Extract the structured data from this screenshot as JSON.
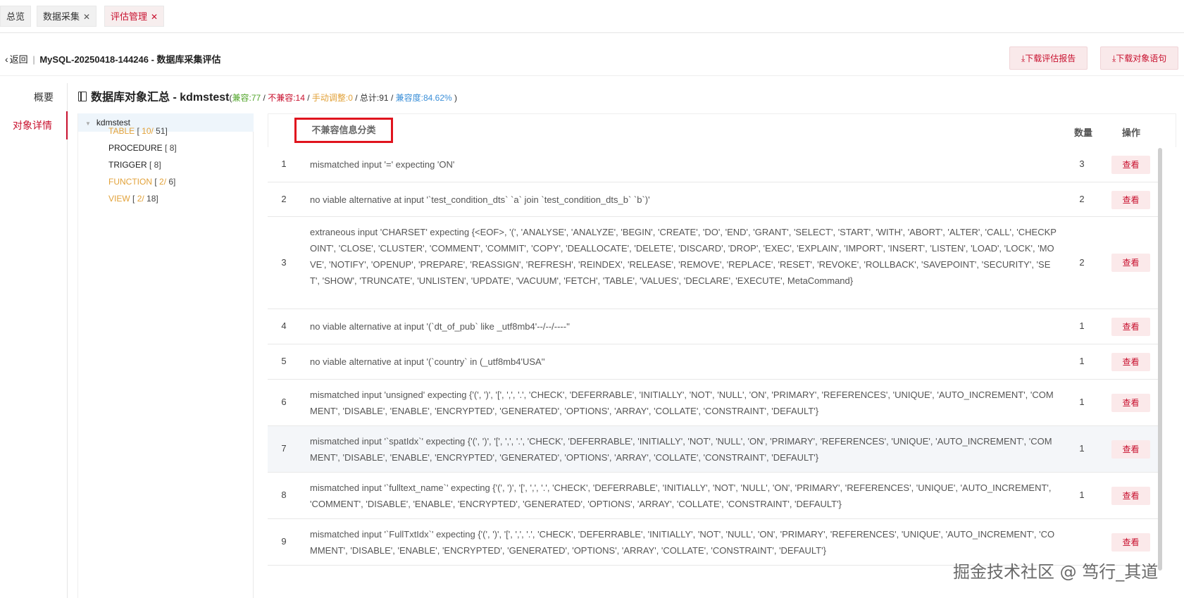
{
  "tabs": [
    {
      "label": "总览",
      "closable": false,
      "active": false
    },
    {
      "label": "数据采集",
      "closable": true,
      "active": false
    },
    {
      "label": "评估管理",
      "closable": true,
      "active": true
    }
  ],
  "header": {
    "back_label": "返回",
    "separator": "|",
    "title": "MySQL-20250418-144246 - 数据库采集评估",
    "download_report_label": "⤓下载评估报告",
    "download_objects_label": "⤓下载对象语句"
  },
  "left_nav": [
    {
      "label": "概要",
      "active": false
    },
    {
      "label": "对象详情",
      "active": true
    }
  ],
  "section": {
    "title": "数据库对象汇总 - kdmstest",
    "stats": {
      "open": "(",
      "compatible": "兼容:77",
      "s1": " / ",
      "incompatible": "不兼容:14",
      "s2": " / ",
      "manual": "手动调整:0",
      "s3": " / ",
      "total": "总计:91",
      "s4": " / ",
      "compat_rate": "兼容度:84.62%",
      "close": " )"
    }
  },
  "tree": {
    "root": "kdmstest",
    "nodes": [
      {
        "label": "TABLE",
        "err": "10/",
        "count": " 51]",
        "open": " [ ",
        "warn": true
      },
      {
        "label": "PROCEDURE",
        "err": "",
        "count": " 8]",
        "open": " [",
        "warn": false
      },
      {
        "label": "TRIGGER",
        "err": "",
        "count": " 8]",
        "open": " [",
        "warn": false
      },
      {
        "label": "FUNCTION",
        "err": "2/",
        "count": " 6]",
        "open": " [ ",
        "warn": true
      },
      {
        "label": "VIEW",
        "err": "2/",
        "count": " 18]",
        "open": " [ ",
        "warn": true
      }
    ]
  },
  "table": {
    "col_category": "不兼容信息分类",
    "col_qty": "数量",
    "col_op": "操作",
    "view_label": "查看",
    "rows": [
      {
        "num": "1",
        "msg": "mismatched input '=' expecting 'ON'",
        "qty": "3"
      },
      {
        "num": "2",
        "msg": "no viable alternative at input '`test_condition_dts` `a` join `test_condition_dts_b` `b`)'",
        "qty": "2"
      },
      {
        "num": "3",
        "msg": "extraneous input 'CHARSET' expecting {<EOF>, '(', 'ANALYSE', 'ANALYZE', 'BEGIN', 'CREATE', 'DO', 'END', 'GRANT', 'SELECT', 'START', 'WITH', 'ABORT', 'ALTER', 'CALL', 'CHECKPOINT', 'CLOSE', 'CLUSTER', 'COMMENT', 'COMMIT', 'COPY', 'DEALLOCATE', 'DELETE', 'DISCARD', 'DROP', 'EXEC', 'EXPLAIN', 'IMPORT', 'INSERT', 'LISTEN', 'LOAD', 'LOCK', 'MOVE', 'NOTIFY', 'OPENUP', 'PREPARE', 'REASSIGN', 'REFRESH', 'REINDEX', 'RELEASE', 'REMOVE', 'REPLACE', 'RESET', 'REVOKE', 'ROLLBACK', 'SAVEPOINT', 'SECURITY', 'SET', 'SHOW', 'TRUNCATE', 'UNLISTEN', 'UPDATE', 'VACUUM', 'FETCH', 'TABLE', 'VALUES', 'DECLARE', 'EXECUTE', MetaCommand}",
        "qty": "2"
      },
      {
        "num": "4",
        "msg": "no viable alternative at input '(`dt_of_pub` like _utf8mb4'--/--/----''",
        "qty": "1"
      },
      {
        "num": "5",
        "msg": "no viable alternative at input '(`country` in (_utf8mb4'USA''",
        "qty": "1"
      },
      {
        "num": "6",
        "msg": "mismatched input 'unsigned' expecting {'(', ')', '[', ',', '.', 'CHECK', 'DEFERRABLE', 'INITIALLY', 'NOT', 'NULL', 'ON', 'PRIMARY', 'REFERENCES', 'UNIQUE', 'AUTO_INCREMENT', 'COMMENT', 'DISABLE', 'ENABLE', 'ENCRYPTED', 'GENERATED', 'OPTIONS', 'ARRAY', 'COLLATE', 'CONSTRAINT', 'DEFAULT'}",
        "qty": "1"
      },
      {
        "num": "7",
        "msg": "mismatched input '`spatIdx`' expecting {'(', ')', '[', ',', '.', 'CHECK', 'DEFERRABLE', 'INITIALLY', 'NOT', 'NULL', 'ON', 'PRIMARY', 'REFERENCES', 'UNIQUE', 'AUTO_INCREMENT', 'COMMENT', 'DISABLE', 'ENABLE', 'ENCRYPTED', 'GENERATED', 'OPTIONS', 'ARRAY', 'COLLATE', 'CONSTRAINT', 'DEFAULT'}",
        "qty": "1"
      },
      {
        "num": "8",
        "msg": "mismatched input '`fulltext_name`' expecting {'(', ')', '[', ',', '.', 'CHECK', 'DEFERRABLE', 'INITIALLY', 'NOT', 'NULL', 'ON', 'PRIMARY', 'REFERENCES', 'UNIQUE', 'AUTO_INCREMENT', 'COMMENT', 'DISABLE', 'ENABLE', 'ENCRYPTED', 'GENERATED', 'OPTIONS', 'ARRAY', 'COLLATE', 'CONSTRAINT', 'DEFAULT'}",
        "qty": "1"
      },
      {
        "num": "9",
        "msg": "mismatched input '`FullTxtIdx`' expecting {'(', ')', '[', ',', '.', 'CHECK', 'DEFERRABLE', 'INITIALLY', 'NOT', 'NULL', 'ON', 'PRIMARY', 'REFERENCES', 'UNIQUE', 'AUTO_INCREMENT', 'COMMENT', 'DISABLE', 'ENABLE', 'ENCRYPTED', 'GENERATED', 'OPTIONS', 'ARRAY', 'COLLATE', 'CONSTRAINT', 'DEFAULT'}",
        "qty": ""
      }
    ]
  },
  "watermark": "掘金技术社区 @ 笃行_其道",
  "colors": {
    "accent": "#c8102e",
    "compatible": "#52a52b",
    "manual": "#e2a23a",
    "rate": "#3b8fd8"
  }
}
